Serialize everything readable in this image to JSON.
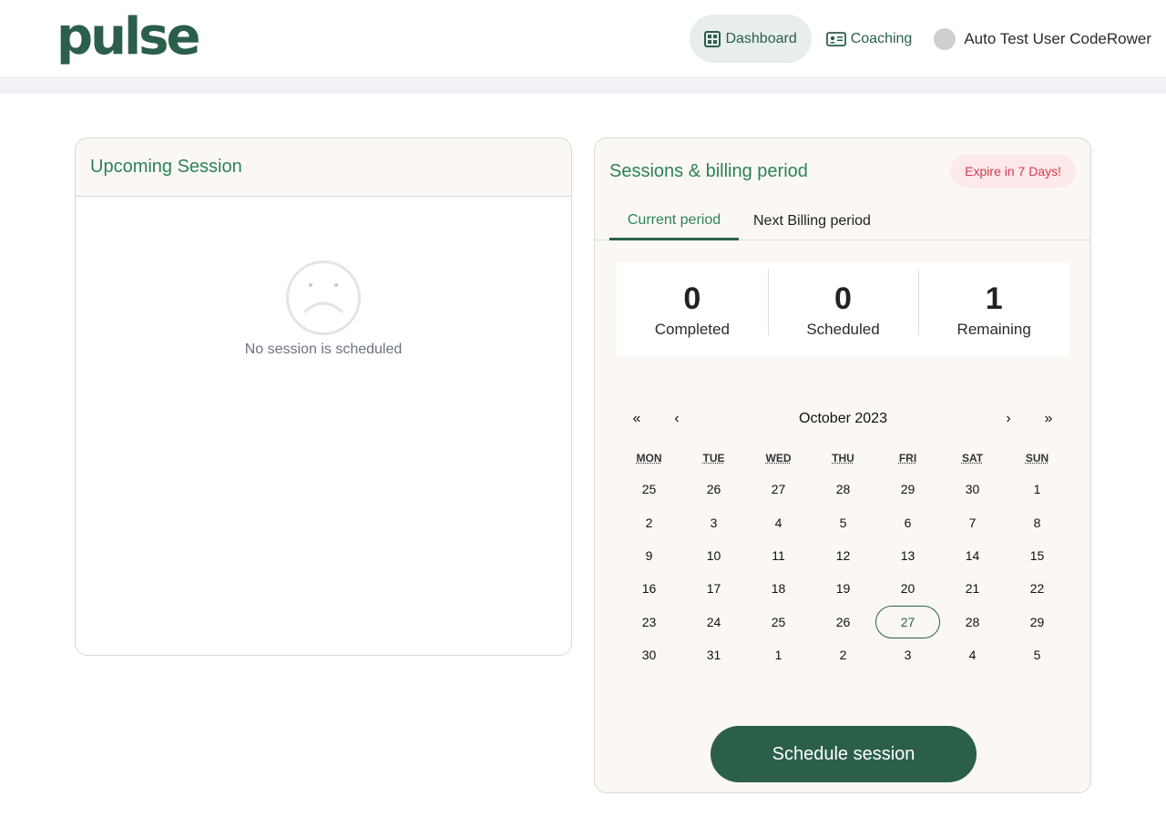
{
  "header": {
    "logo": "pulse",
    "nav": [
      {
        "label": "Dashboard",
        "icon": "dashboard-grid-icon",
        "active": true
      },
      {
        "label": "Coaching",
        "icon": "id-card-icon",
        "active": false
      }
    ],
    "user_name": "Auto Test User CodeRower"
  },
  "upcoming": {
    "title": "Upcoming Session",
    "empty_icon": "sad-face-icon",
    "empty_text": "No session is scheduled"
  },
  "billing": {
    "title": "Sessions & billing period",
    "badge": "Expire in 7 Days!",
    "tabs": [
      {
        "label": "Current period",
        "active": true
      },
      {
        "label": "Next Billing period",
        "active": false
      }
    ],
    "stats": [
      {
        "value": "0",
        "label": "Completed"
      },
      {
        "value": "0",
        "label": "Scheduled"
      },
      {
        "value": "1",
        "label": "Remaining"
      }
    ]
  },
  "calendar": {
    "prev_year": "«",
    "prev_month": "‹",
    "month_label": "October 2023",
    "next_month": "›",
    "next_year": "»",
    "weekdays": [
      "MON",
      "TUE",
      "WED",
      "THU",
      "FRI",
      "SAT",
      "SUN"
    ],
    "weeks": [
      [
        "25",
        "26",
        "27",
        "28",
        "29",
        "30",
        "1"
      ],
      [
        "2",
        "3",
        "4",
        "5",
        "6",
        "7",
        "8"
      ],
      [
        "9",
        "10",
        "11",
        "12",
        "13",
        "14",
        "15"
      ],
      [
        "16",
        "17",
        "18",
        "19",
        "20",
        "21",
        "22"
      ],
      [
        "23",
        "24",
        "25",
        "26",
        "27",
        "28",
        "29"
      ],
      [
        "30",
        "31",
        "1",
        "2",
        "3",
        "4",
        "5"
      ]
    ],
    "today": "27"
  },
  "actions": {
    "schedule_label": "Schedule session"
  },
  "colors": {
    "brand_green": "#2b5f4a",
    "title_green": "#2b8259",
    "badge_bg": "#fde8ea",
    "badge_text": "#d23c4e",
    "card_bg": "#fbf8f4"
  }
}
